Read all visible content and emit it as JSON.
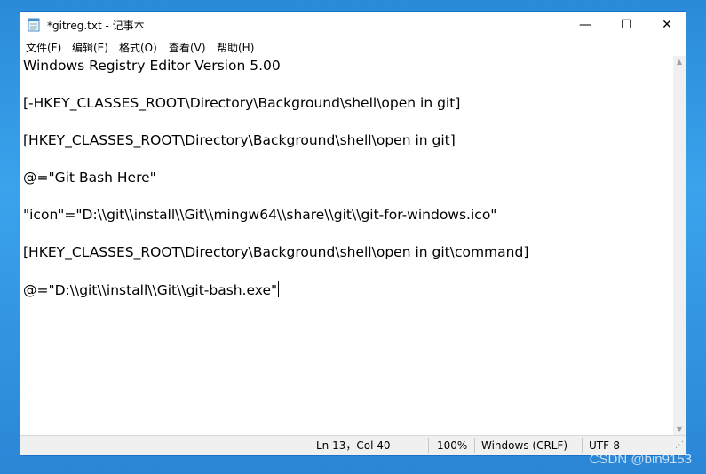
{
  "window": {
    "title": "*gitreg.txt - 记事本",
    "icon": "notepad-icon",
    "controls": {
      "minimize": "—",
      "maximize": "☐",
      "close": "✕"
    }
  },
  "menu": [
    {
      "label": "文件(F)"
    },
    {
      "label": "编辑(E)"
    },
    {
      "label": "格式(O)"
    },
    {
      "label": "查看(V)"
    },
    {
      "label": "帮助(H)"
    }
  ],
  "editor": {
    "lines": [
      "Windows Registry Editor Version 5.00",
      "[-HKEY_CLASSES_ROOT\\Directory\\Background\\shell\\open in git]",
      "[HKEY_CLASSES_ROOT\\Directory\\Background\\shell\\open in git]",
      "@=\"Git Bash Here\"",
      "\"icon\"=\"D:\\\\git\\\\install\\\\Git\\\\mingw64\\\\share\\\\git\\\\git-for-windows.ico\"",
      "[HKEY_CLASSES_ROOT\\Directory\\Background\\shell\\open in git\\command]",
      "@=\"D:\\\\git\\\\install\\\\Git\\\\git-bash.exe\""
    ]
  },
  "status": {
    "position": "Ln 13，Col 40",
    "zoom": "100%",
    "line_ending": "Windows (CRLF)",
    "encoding": "UTF-8"
  },
  "watermark": "CSDN @bin9153"
}
